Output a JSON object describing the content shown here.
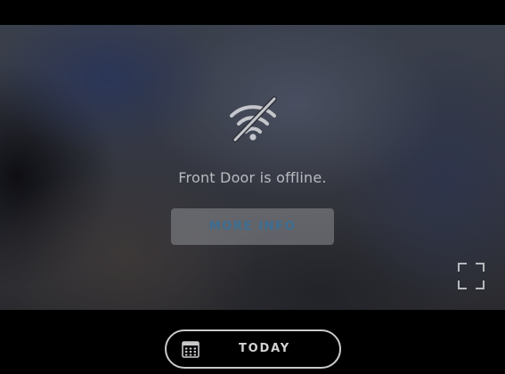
{
  "camera": {
    "status_message": "Front Door is offline.",
    "more_info_label": "MORE INFO",
    "status_icon": "wifi-off-icon",
    "fullscreen_icon": "fullscreen-icon"
  },
  "timeline": {
    "today_label": "TODAY",
    "calendar_icon": "calendar-icon"
  },
  "colors": {
    "button_text_accent": "#3c6e93",
    "message_text": "#b9bbc0",
    "background": "#000000"
  }
}
